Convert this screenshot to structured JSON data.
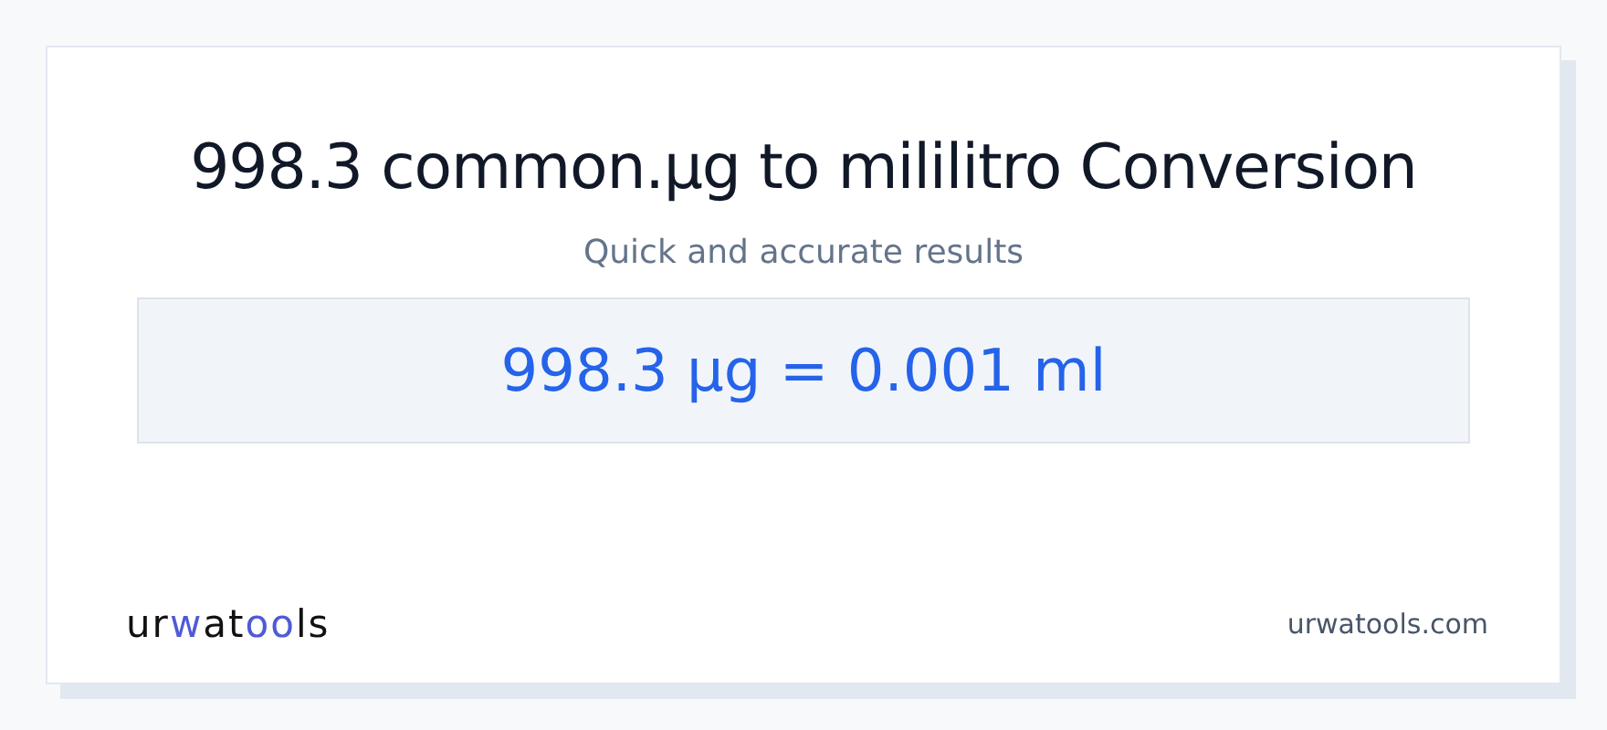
{
  "title": "998.3 common.µg to mililitro Conversion",
  "subtitle": "Quick and accurate results",
  "result": "998.3 µg = 0.001 ml",
  "logo": [
    {
      "text": "ur",
      "accent": false
    },
    {
      "text": "w",
      "accent": true
    },
    {
      "text": "at",
      "accent": false
    },
    {
      "text": "oo",
      "accent": true
    },
    {
      "text": "ls",
      "accent": false
    }
  ],
  "site": "urwatools.com"
}
